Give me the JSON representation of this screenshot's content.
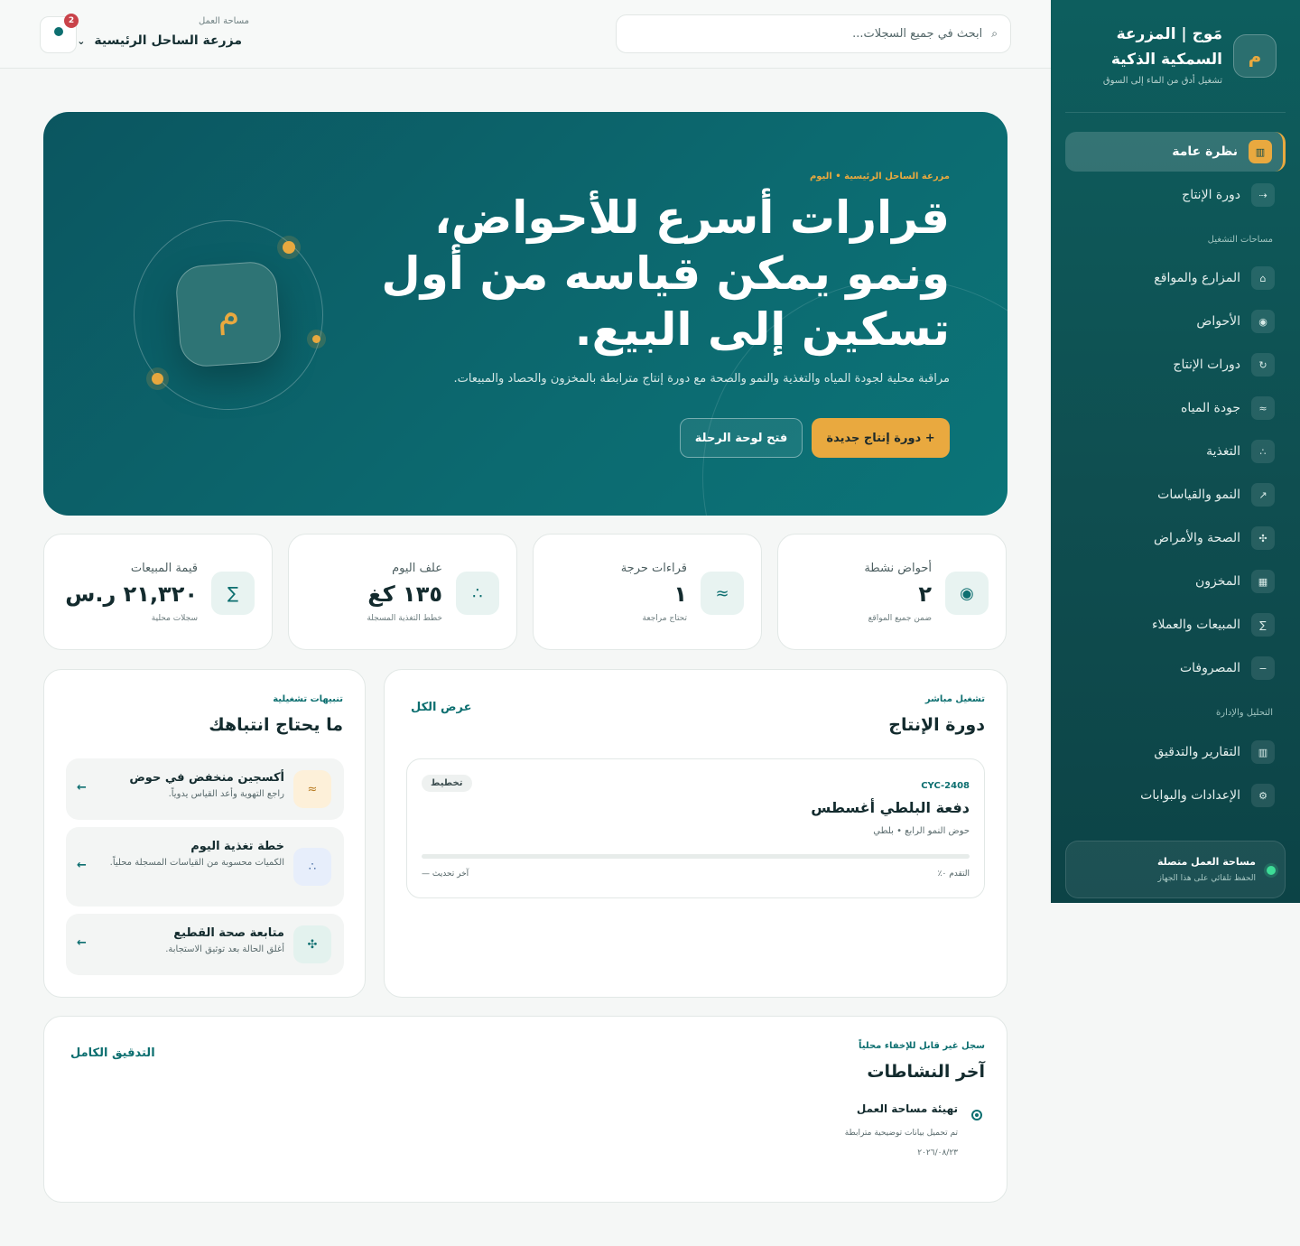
{
  "brand": {
    "logo_letter": "م",
    "title": "مَوج | المزرعة السمكية الذكية",
    "subtitle": "تشغيل أدق من الماء إلى السوق"
  },
  "nav": {
    "top_items": [
      {
        "label": "نظرة عامة",
        "icon": "▥",
        "active": true
      },
      {
        "label": "دورة الإنتاج",
        "icon": "⇢"
      }
    ],
    "ops_section": "مساحات التشغيل",
    "ops_items": [
      {
        "label": "المزارع والمواقع",
        "icon": "⌂"
      },
      {
        "label": "الأحواض",
        "icon": "◉"
      },
      {
        "label": "دورات الإنتاج",
        "icon": "↻"
      },
      {
        "label": "جودة المياه",
        "icon": "≈"
      },
      {
        "label": "التغذية",
        "icon": "∴"
      },
      {
        "label": "النمو والقياسات",
        "icon": "↗"
      },
      {
        "label": "الصحة والأمراض",
        "icon": "✣"
      },
      {
        "label": "المخزون",
        "icon": "▦"
      },
      {
        "label": "المبيعات والعملاء",
        "icon": "∑"
      },
      {
        "label": "المصروفات",
        "icon": "−"
      }
    ],
    "admin_section": "التحليل والإدارة",
    "admin_items": [
      {
        "label": "التقارير والتدقيق",
        "icon": "▥"
      },
      {
        "label": "الإعدادات والبوابات",
        "icon": "⚙"
      }
    ],
    "status": {
      "title": "مساحة العمل متصلة",
      "subtitle": "الحفظ تلقائي على هذا الجهاز"
    }
  },
  "topbar": {
    "search_placeholder": "ابحث في جميع السجلات...",
    "workspace_label": "مساحة العمل",
    "workspace_name": "مزرعة الساحل الرئيسية",
    "notification_count": "2"
  },
  "hero": {
    "kicker": "مزرعة الساحل الرئيسية • اليوم",
    "title": "قرارات أسرع للأحواض، ونمو يمكن قياسه من أول تسكين إلى البيع.",
    "description": "مراقبة محلية لجودة المياه والتغذية والنمو والصحة مع دورة إنتاج مترابطة بالمخزون والحصاد والمبيعات.",
    "primary_button": "+ دورة إنتاج جديدة",
    "secondary_button": "فتح لوحة الرحلة",
    "badge_letter": "م"
  },
  "stats": [
    {
      "label": "أحواض نشطة",
      "value": "٢",
      "note": "ضمن جميع المواقع",
      "icon": "◉"
    },
    {
      "label": "قراءات حرجة",
      "value": "١",
      "note": "تحتاج مراجعة",
      "icon": "≈"
    },
    {
      "label": "علف اليوم",
      "value": "١٣٥ كغ",
      "note": "خطط التغذية المسجلة",
      "icon": "∴"
    },
    {
      "label": "قيمة المبيعات",
      "value": "٢١,٣٢٠ ر.س",
      "note": "سجلات محلية",
      "icon": "∑"
    }
  ],
  "production": {
    "kicker": "تشغيل مباشر",
    "title": "دورة الإنتاج",
    "view_all": "عرض الكل",
    "cycle": {
      "code": "CYC-2408",
      "name": "دفعة البلطي أغسطس",
      "meta": "حوض النمو الرابع • بلطي",
      "status": "تخطيط",
      "progress_label": "التقدم ٠٪",
      "progress": 0,
      "updated_label": "آخر تحديث —"
    }
  },
  "alerts": {
    "kicker": "تنبيهات تشغيلية",
    "title": "ما يحتاج انتباهك",
    "items": [
      {
        "title": "أكسجين منخفض في حوض",
        "desc": "راجع التهوية وأعد القياس يدوياً.",
        "icon": "≈",
        "color": "#fdf0d9",
        "icon_color": "#b7791f"
      },
      {
        "title": "خطة تغذية اليوم",
        "desc": "الكميات محسوبة من القياسات المسجلة محلياً.",
        "icon": "∴",
        "color": "#e7eefb",
        "icon_color": "#4a6fa5"
      },
      {
        "title": "متابعة صحة القطيع",
        "desc": "أغلق الحالة بعد توثيق الاستجابة.",
        "icon": "✣",
        "color": "#e3f2ee",
        "icon_color": "#0d6f70"
      }
    ],
    "arrow": "←"
  },
  "activity": {
    "kicker": "سجل غير قابل للإخفاء محلياً",
    "title": "آخر النشاطات",
    "full_audit": "التدقيق الكامل",
    "items": [
      {
        "title": "تهيئة مساحة العمل",
        "desc": "تم تحميل بيانات توضيحية مترابطة",
        "date": "٢٠٢٦/٠٨/٢٣"
      }
    ]
  }
}
